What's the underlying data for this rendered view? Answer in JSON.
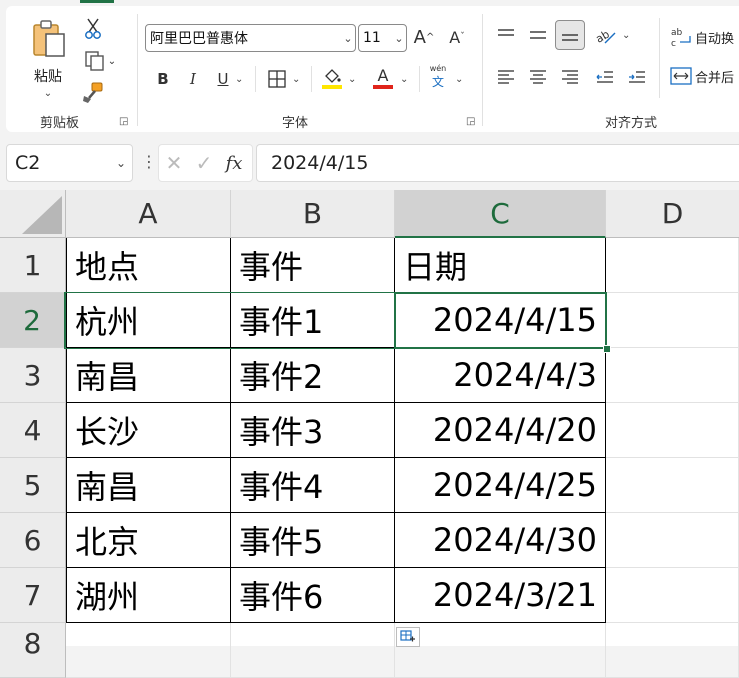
{
  "clipboard": {
    "paste_label": "粘贴",
    "group_label": "剪贴板"
  },
  "font": {
    "name": "阿里巴巴普惠体",
    "size": "11",
    "phonetic_label": "wén",
    "phonetic_char": "文",
    "group_label": "字体",
    "bold": "B",
    "italic": "I",
    "underline": "U",
    "font_color_letter": "A"
  },
  "alignment": {
    "wrap_label": "自动换",
    "merge_label": "合并后",
    "group_label": "对齐方式"
  },
  "formula_bar": {
    "name_box": "C2",
    "fx": "fx",
    "formula": "2024/4/15"
  },
  "colors": {
    "accent": "#217346",
    "font_color": "#e0241b",
    "fill_color": "#ffe600"
  },
  "columns": [
    "A",
    "B",
    "C",
    "D"
  ],
  "rows": [
    "1",
    "2",
    "3",
    "4",
    "5",
    "6",
    "7",
    "8"
  ],
  "table": [
    [
      "地点",
      "事件",
      "日期"
    ],
    [
      "杭州",
      "事件1",
      "2024/4/15"
    ],
    [
      "南昌",
      "事件2",
      "2024/4/3"
    ],
    [
      "长沙",
      "事件3",
      "2024/4/20"
    ],
    [
      "南昌",
      "事件4",
      "2024/4/25"
    ],
    [
      "北京",
      "事件5",
      "2024/4/30"
    ],
    [
      "湖州",
      "事件6",
      "2024/3/21"
    ]
  ]
}
